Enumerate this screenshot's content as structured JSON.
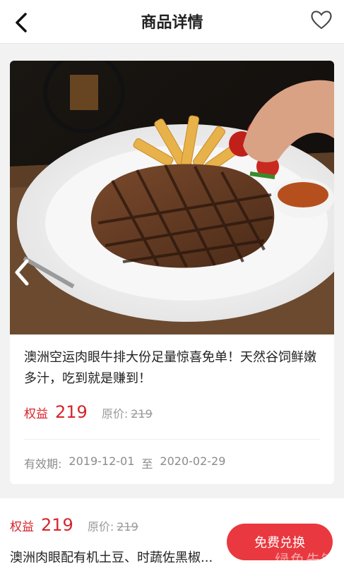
{
  "header": {
    "title": "商品详情",
    "back_icon": "chevron-left-icon",
    "favorite_icon": "heart-outline-icon"
  },
  "product": {
    "image_alt": "steak-photo",
    "description": "澳洲空运肉眼牛排大份足量惊喜免单！天然谷饲鲜嫩多汁，吃到就是赚到！",
    "quanyi_label": "权益",
    "price": "219",
    "orig_label": "原价:",
    "orig_price": "219",
    "validity_label": "有效期:",
    "validity_start": "2019-12-01",
    "validity_sep": "至",
    "validity_end": "2020-02-29"
  },
  "next_item": {
    "quanyi_label": "权益",
    "price": "219",
    "orig_label": "原价:",
    "orig_price": "219",
    "title": "澳洲肉眼配有机土豆、时蔬佐黑椒..."
  },
  "redeem_button": "免费兑换",
  "watermark": "绿色先锋",
  "colors": {
    "accent": "#d8232a",
    "button": "#e9383f"
  }
}
